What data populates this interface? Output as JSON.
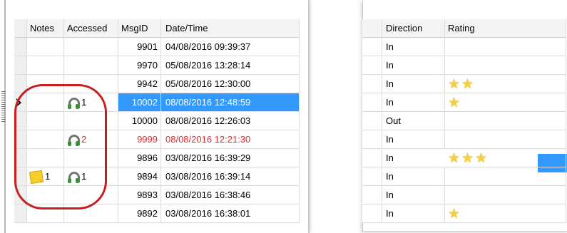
{
  "left": {
    "headers": {
      "notes": "Notes",
      "accessed": "Accessed",
      "msgid": "MsgID",
      "datetime": "Date/Time"
    },
    "rows": [
      {
        "notes": "",
        "accessed": "",
        "msgid": "9901",
        "datetime": "04/08/2016 09:39:37"
      },
      {
        "notes": "",
        "accessed": "",
        "msgid": "9970",
        "datetime": "05/08/2016 13:28:14"
      },
      {
        "notes": "",
        "accessed": "",
        "msgid": "9942",
        "datetime": "05/08/2016 12:30:00"
      },
      {
        "notes": "",
        "accessed": "1",
        "msgid": "10002",
        "datetime": "08/08/2016 12:48:59",
        "selected": true
      },
      {
        "notes": "",
        "accessed": "",
        "msgid": "10000",
        "datetime": "08/08/2016 12:26:03"
      },
      {
        "notes": "",
        "accessed": "2",
        "msgid": "9999",
        "datetime": "08/08/2016 12:21:30",
        "highlight_color": "#e8262b"
      },
      {
        "notes": "",
        "accessed": "",
        "msgid": "9896",
        "datetime": "03/08/2016 16:39:29"
      },
      {
        "notes": "1",
        "accessed": "1",
        "msgid": "9894",
        "datetime": "03/08/2016 16:39:14"
      },
      {
        "notes": "",
        "accessed": "",
        "msgid": "9893",
        "datetime": "03/08/2016 16:38:46"
      },
      {
        "notes": "",
        "accessed": "",
        "msgid": "9892",
        "datetime": "03/08/2016 16:38:01"
      }
    ]
  },
  "right": {
    "headers": {
      "direction": "Direction",
      "rating": "Rating"
    },
    "rows": [
      {
        "direction": "In",
        "stars": 0
      },
      {
        "direction": "In",
        "stars": 0
      },
      {
        "direction": "In",
        "stars": 2
      },
      {
        "direction": "In",
        "stars": 1
      },
      {
        "direction": "Out",
        "stars": 0
      },
      {
        "direction": "In",
        "stars": 0
      },
      {
        "direction": "In",
        "stars": 3,
        "selected": true
      },
      {
        "direction": "In",
        "stars": 0
      },
      {
        "direction": "In",
        "stars": 0
      },
      {
        "direction": "In",
        "stars": 1
      }
    ]
  },
  "icons": {
    "notes": "sticky-note-icon",
    "accessed": "headphones-icon",
    "rating": "star-icon",
    "row_pointer": "row-pointer-arrow-icon"
  },
  "colors": {
    "selection": "#3399ff",
    "annotation_circle": "#c81e1e",
    "star": "#f5cf3c",
    "alert_text": "#e8262b"
  }
}
